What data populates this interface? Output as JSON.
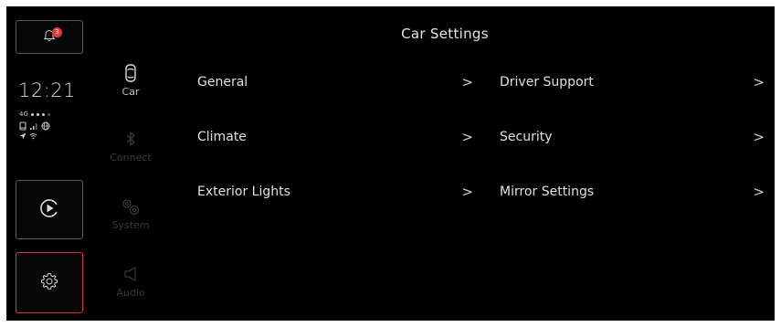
{
  "app": {
    "title": "Car Settings"
  },
  "rail": {
    "notification_badge": "3",
    "time": "12:21",
    "network": "4G"
  },
  "categories": [
    {
      "label": "Car",
      "icon": "car-icon",
      "active": true
    },
    {
      "label": "Connect",
      "icon": "bluetooth-icon",
      "active": false
    },
    {
      "label": "System",
      "icon": "gears-icon",
      "active": false
    },
    {
      "label": "Audio",
      "icon": "speaker-icon",
      "active": false
    }
  ],
  "menu": {
    "left": [
      {
        "label": "General"
      },
      {
        "label": "Climate"
      },
      {
        "label": "Exterior Lights"
      }
    ],
    "right": [
      {
        "label": "Driver Support"
      },
      {
        "label": "Security"
      },
      {
        "label": "Mirror Settings"
      }
    ],
    "chevron": ">"
  },
  "colors": {
    "background": "#000000",
    "text": "#e0e0e0",
    "active_outline": "#d33838",
    "badge": "#e53935"
  }
}
